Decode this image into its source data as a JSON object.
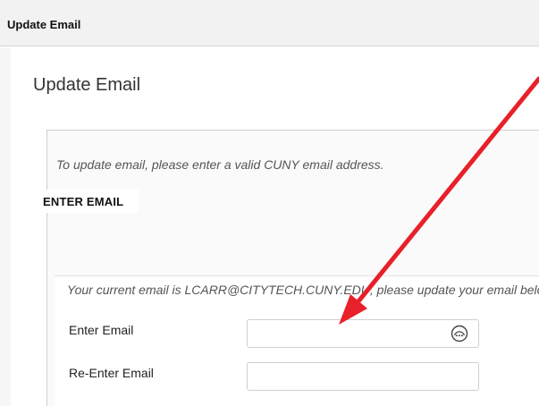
{
  "header": {
    "title": "Update Email"
  },
  "page": {
    "title": "Update Email"
  },
  "instructions": "To update email, please enter a valid CUNY email address.",
  "section": {
    "label": "ENTER EMAIL"
  },
  "form": {
    "current_email_text": "Your current email is LCARR@CITYTECH.CUNY.EDU, please update your email below.",
    "fields": [
      {
        "label": "Enter Email",
        "value": "",
        "icon": "password-manager-icon"
      },
      {
        "label": "Re-Enter Email",
        "value": ""
      }
    ]
  },
  "colors": {
    "annotation_arrow": "#e8202a"
  },
  "icons": [
    "password-manager-icon",
    "annotation-arrow"
  ]
}
